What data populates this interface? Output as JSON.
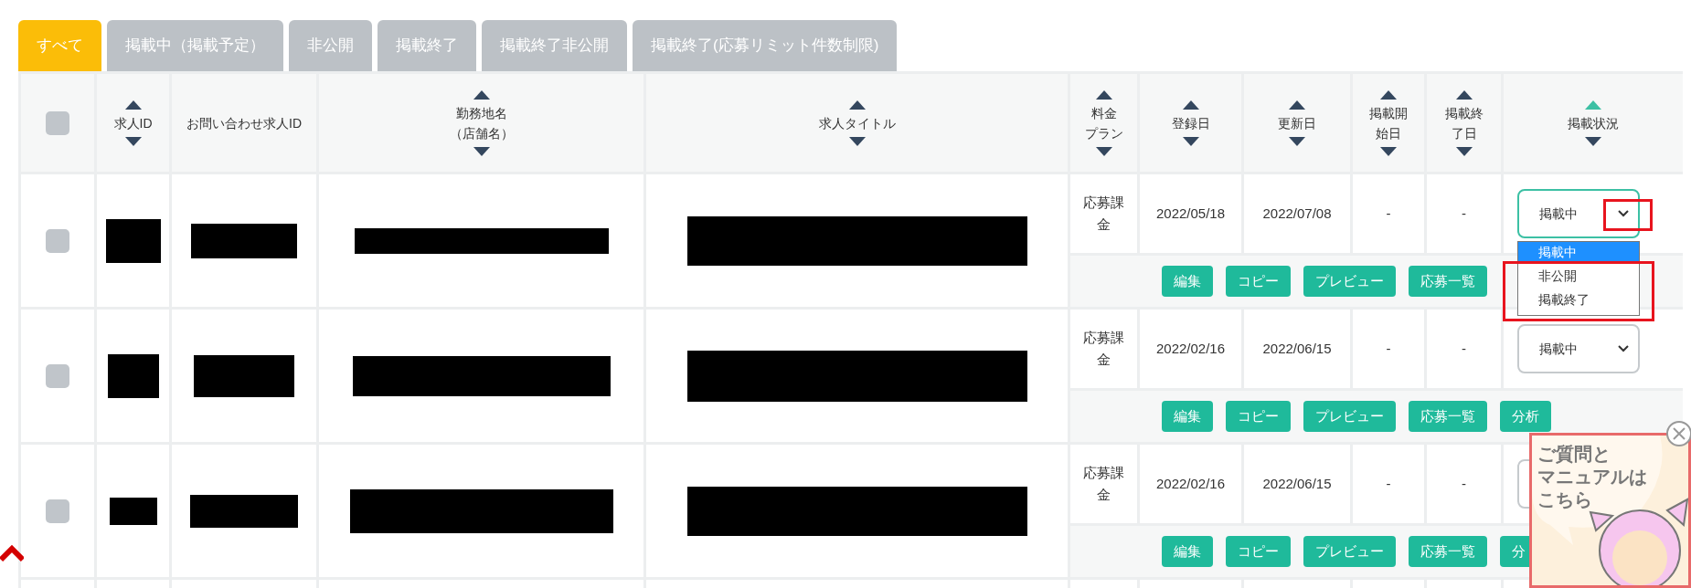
{
  "tabs": [
    {
      "label": "すべて",
      "selected": true
    },
    {
      "label": "掲載中（掲載予定）",
      "selected": false
    },
    {
      "label": "非公開",
      "selected": false
    },
    {
      "label": "掲載終了",
      "selected": false
    },
    {
      "label": "掲載終了非公開",
      "selected": false
    },
    {
      "label": "掲載終了(応募リミット件数制限)",
      "selected": false
    }
  ],
  "table": {
    "select_all": {
      "checked": false
    },
    "columns": [
      {
        "lines": [
          "求人ID"
        ],
        "sortable": true,
        "sorted": false
      },
      {
        "lines": [
          "お問い合わせ求人ID"
        ],
        "sortable": false
      },
      {
        "lines": [
          "勤務地名",
          "（店舗名）"
        ],
        "sortable": true,
        "sorted": false
      },
      {
        "lines": [
          "求人タイトル"
        ],
        "sortable": true,
        "sorted": false
      },
      {
        "lines": [
          "料金",
          "プラン"
        ],
        "sortable": true,
        "sorted": false
      },
      {
        "lines": [
          "登録日"
        ],
        "sortable": true,
        "sorted": false
      },
      {
        "lines": [
          "更新日"
        ],
        "sortable": true,
        "sorted": false
      },
      {
        "lines": [
          "掲載開",
          "始日"
        ],
        "sortable": true,
        "sorted": false
      },
      {
        "lines": [
          "掲載終",
          "了日"
        ],
        "sortable": true,
        "sorted": false
      },
      {
        "lines": [
          "掲載状況"
        ],
        "sortable": true,
        "sorted": true
      }
    ],
    "rows": [
      {
        "checked": false,
        "plan": "応募課金",
        "registered": "2022/05/18",
        "updated": "2022/07/08",
        "start": "-",
        "end": "-",
        "status": {
          "value": "掲載中",
          "focused": true,
          "options": [
            {
              "label": "掲載中",
              "selected": true
            },
            {
              "label": "非公開",
              "selected": false
            },
            {
              "label": "掲載終了",
              "selected": false
            }
          ]
        },
        "actions": [
          "編集",
          "コピー",
          "プレビュー",
          "応募一覧"
        ]
      },
      {
        "checked": false,
        "plan": "応募課金",
        "registered": "2022/02/16",
        "updated": "2022/06/15",
        "start": "-",
        "end": "-",
        "status": {
          "value": "掲載中",
          "focused": false
        },
        "actions": [
          "編集",
          "コピー",
          "プレビュー",
          "応募一覧",
          "分析"
        ]
      },
      {
        "checked": false,
        "plan": "応募課金",
        "registered": "2022/02/16",
        "updated": "2022/06/15",
        "start": "-",
        "end": "-",
        "actions": [
          "編集",
          "コピー",
          "プレビュー",
          "応募一覧",
          "分"
        ]
      }
    ]
  },
  "help_widget": {
    "lines": [
      "ご質問と",
      "マニュアルは",
      "こちら"
    ]
  }
}
